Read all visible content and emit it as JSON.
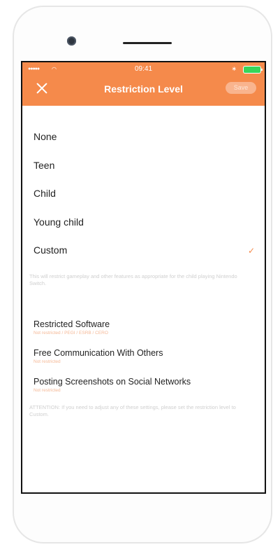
{
  "status_bar": {
    "signal": "●●●●●",
    "time": "09:41"
  },
  "header": {
    "title": "Restriction Level",
    "save_label": "Save"
  },
  "levels": [
    {
      "label": "None"
    },
    {
      "label": "Teen"
    },
    {
      "label": "Child"
    },
    {
      "label": "Young child"
    },
    {
      "label": "Custom",
      "selected": true
    }
  ],
  "custom_note": "This will restrict gameplay and other features as appropriate for the child playing Nintendo Switch.",
  "settings": [
    {
      "label": "Restricted Software",
      "value": "Not restricted / PEGI / ESRB / CERO"
    },
    {
      "label": "Free Communication With Others",
      "value": "Not restricted"
    },
    {
      "label": "Posting Screenshots on Social Networks",
      "value": "Not restricted"
    }
  ],
  "attention": "ATTENTION: If you need to adjust any of these settings, please set the restriction level to Custom.",
  "colors": {
    "accent": "#f58a4b",
    "checkmark": "#f58a4b",
    "muted_text": "#cfcfcf",
    "setting_value": "#f5b896"
  }
}
